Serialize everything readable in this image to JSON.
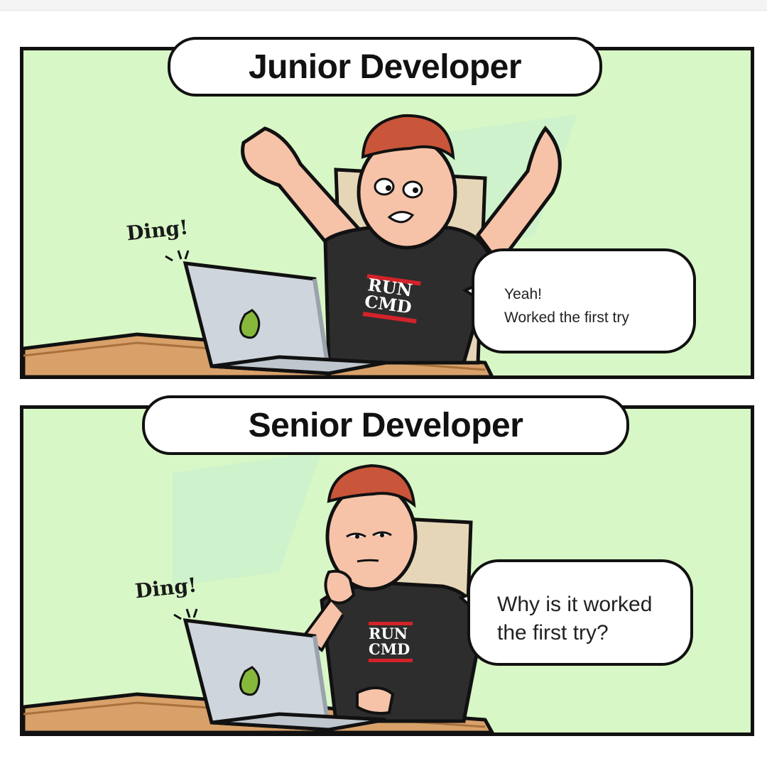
{
  "panels": [
    {
      "title": "Junior Developer",
      "sound": "Ding!",
      "shirt": [
        "RUN",
        "CMD"
      ],
      "speech": [
        "Yeah!",
        "Worked the first try"
      ]
    },
    {
      "title": "Senior Developer",
      "sound": "Ding!",
      "shirt": [
        "RUN",
        "CMD"
      ],
      "speech": [
        "Why is it worked",
        "the first try?"
      ]
    }
  ],
  "colors": {
    "background": "#d8f7c6",
    "outline": "#111111",
    "skin": "#f6c3a8",
    "hair": "#c9553a",
    "shirt": "#2d2d2d",
    "shirt_text": "#ffffff",
    "shirt_stripe": "#d2232a",
    "chair": "#e6d6b8",
    "desk": "#d9a16a",
    "laptop": "#cfd5dc",
    "logo": "#86b83b"
  },
  "icons": [
    "laptop-icon",
    "pear-logo-icon",
    "sound-lines-icon"
  ]
}
